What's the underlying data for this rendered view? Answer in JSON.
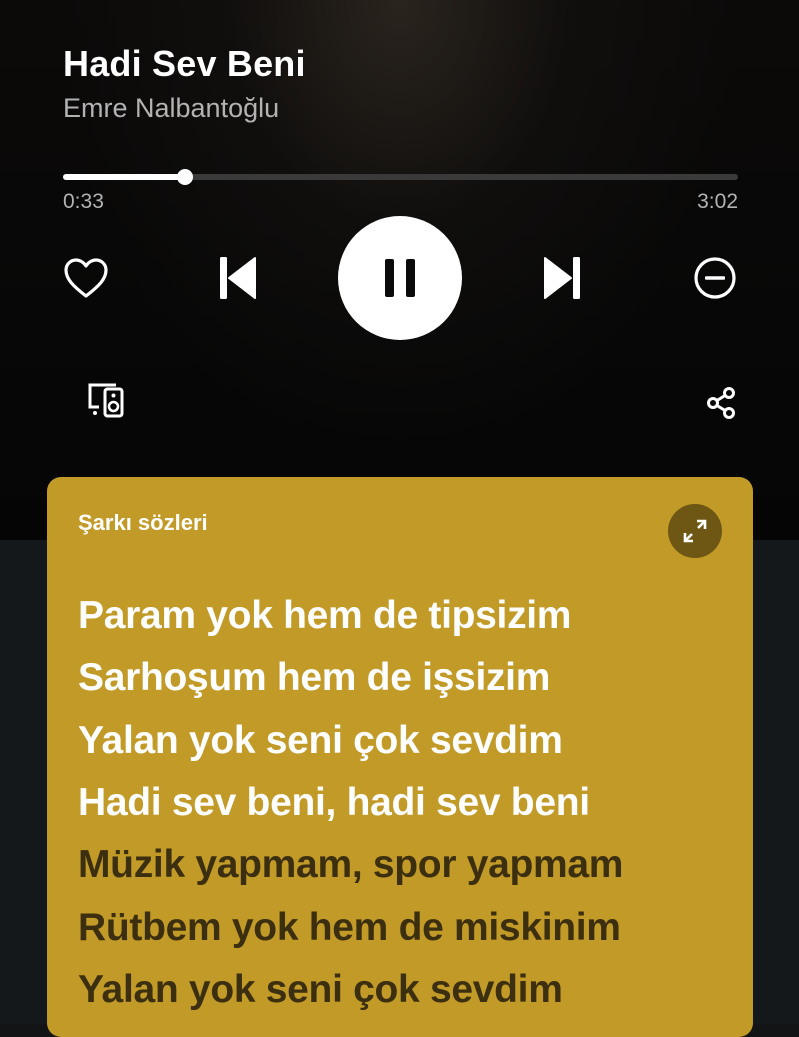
{
  "track": {
    "title": "Hadi Sev Beni",
    "artist": "Emre Nalbantoğlu"
  },
  "playback": {
    "elapsed": "0:33",
    "total": "3:02",
    "progress_fraction": 0.181,
    "state": "playing"
  },
  "controls": {
    "like_icon": "heart-outline-icon",
    "previous_icon": "skip-previous-icon",
    "play_pause_icon": "pause-icon",
    "next_icon": "skip-next-icon",
    "hide_icon": "minus-circle-icon",
    "devices_icon": "connect-devices-icon",
    "share_icon": "share-icon"
  },
  "lyrics": {
    "header": "Şarkı sözleri",
    "expand_icon": "expand-icon",
    "card_color": "#c29a27",
    "lines": [
      {
        "text": "Param yok hem de tipsizim",
        "state": "active"
      },
      {
        "text": "Sarhoşum hem de işsizim",
        "state": "active"
      },
      {
        "text": "Yalan yok seni çok sevdim",
        "state": "active"
      },
      {
        "text": "Hadi sev beni, hadi sev beni",
        "state": "active"
      },
      {
        "text": "Müzik yapmam, spor yapmam",
        "state": "upcoming"
      },
      {
        "text": "Rütbem yok hem de miskinim",
        "state": "upcoming"
      },
      {
        "text": "Yalan yok seni çok sevdim",
        "state": "upcoming"
      }
    ]
  }
}
